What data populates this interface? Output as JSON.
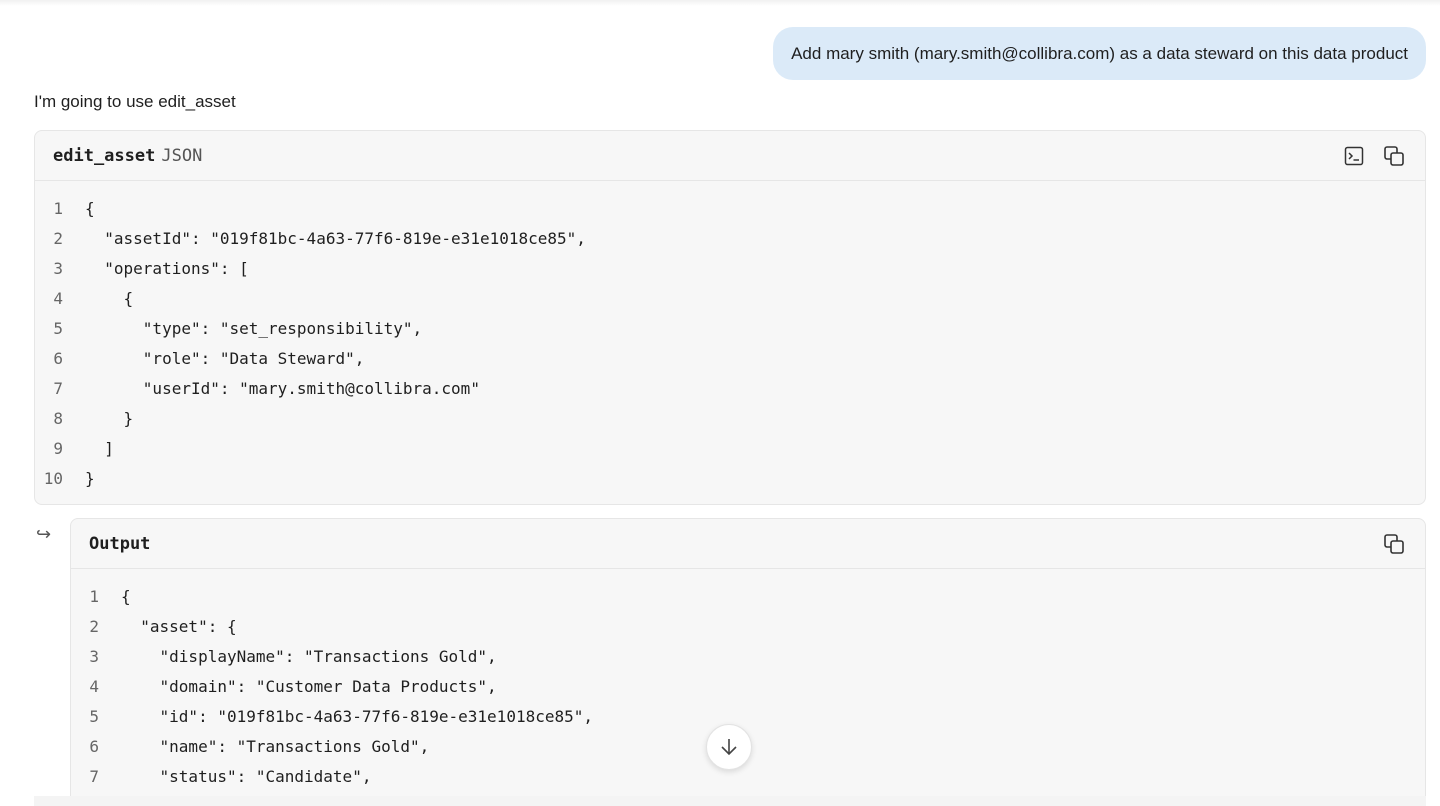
{
  "conversation": {
    "user_message": "Add mary smith (mary.smith@collibra.com) as a data steward on this data product",
    "assistant_intro": "I'm going to use edit_asset"
  },
  "input_block": {
    "tool_name": "edit_asset",
    "language": "JSON",
    "lines": [
      "{",
      "  \"assetId\": \"019f81bc-4a63-77f6-819e-e31e1018ce85\",",
      "  \"operations\": [",
      "    {",
      "      \"type\": \"set_responsibility\",",
      "      \"role\": \"Data Steward\",",
      "      \"userId\": \"mary.smith@collibra.com\"",
      "    }",
      "  ]",
      "}"
    ],
    "actions": [
      "terminal-icon",
      "copy-icon"
    ]
  },
  "output_block": {
    "title": "Output",
    "return_icon": "↪",
    "lines": [
      "{",
      "  \"asset\": {",
      "    \"displayName\": \"Transactions Gold\",",
      "    \"domain\": \"Customer Data Products\",",
      "    \"id\": \"019f81bc-4a63-77f6-819e-e31e1018ce85\",",
      "    \"name\": \"Transactions Gold\",",
      "    \"status\": \"Candidate\","
    ],
    "actions": [
      "copy-icon"
    ]
  },
  "scroll_button": {
    "icon": "arrow-down-icon"
  },
  "colors": {
    "user_bubble": "#dbeaf8",
    "code_bg": "#f7f7f7",
    "border": "#e6e6e6"
  }
}
